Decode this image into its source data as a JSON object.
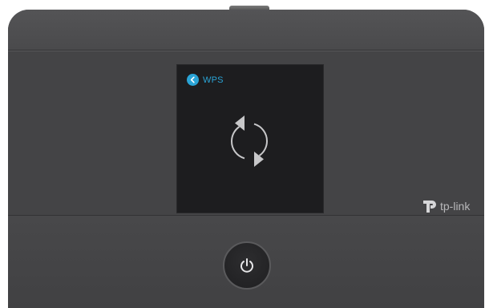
{
  "screen": {
    "title": "WPS",
    "back_icon": "chevron-left-icon",
    "status_icon": "refresh-icon",
    "accent_color": "#2aa4d6"
  },
  "branding": {
    "logo_text": "tp-link"
  },
  "device": {
    "power_icon": "power-icon",
    "body_color": "#4a4a4c"
  }
}
